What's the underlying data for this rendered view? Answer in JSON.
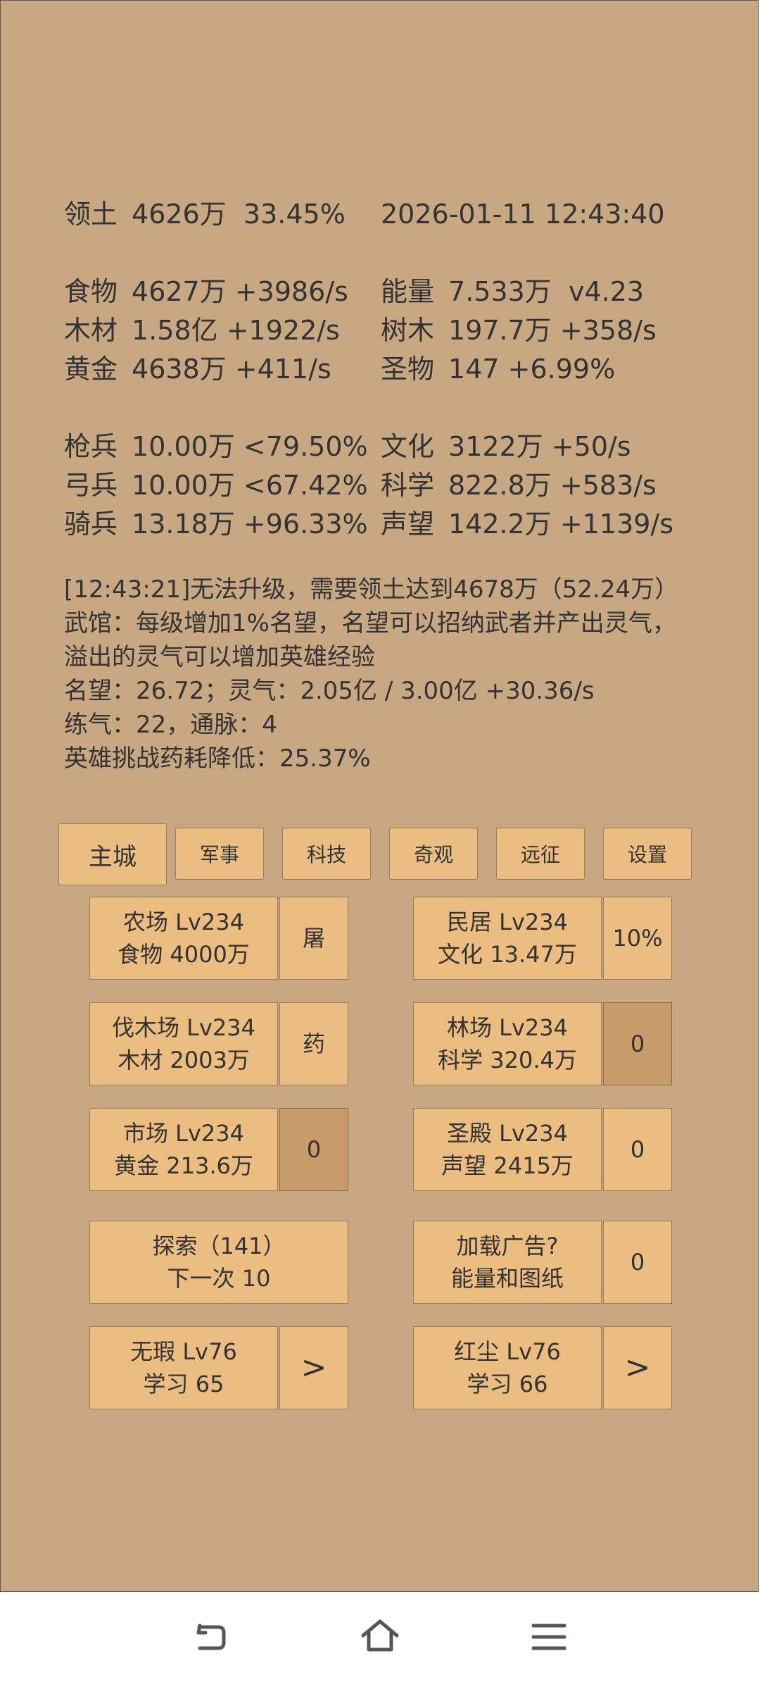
{
  "stats": {
    "territory": {
      "label": "领土",
      "value": "4626万",
      "pct": "33.45%"
    },
    "datetime": "2026-01-11 12:43:40",
    "food": {
      "label": "食物",
      "value": "4627万 +3986/s"
    },
    "energy": {
      "label": "能量",
      "value": "7.533万  v4.23"
    },
    "wood": {
      "label": "木材",
      "value": "1.58亿 +1922/s"
    },
    "trees": {
      "label": "树木",
      "value": "197.7万 +358/s"
    },
    "gold": {
      "label": "黄金",
      "value": "4638万 +411/s"
    },
    "relic": {
      "label": "圣物",
      "value": "147 +6.99%"
    },
    "spear": {
      "label": "枪兵",
      "value": "10.00万 <79.50%"
    },
    "culture": {
      "label": "文化",
      "value": "3122万 +50/s"
    },
    "archer": {
      "label": "弓兵",
      "value": "10.00万 <67.42%"
    },
    "science": {
      "label": "科学",
      "value": "822.8万 +583/s"
    },
    "cavalry": {
      "label": "骑兵",
      "value": "13.18万 +96.33%"
    },
    "fame": {
      "label": "声望",
      "value": "142.2万 +1139/s"
    }
  },
  "log": {
    "line1": "[12:43:21]无法升级，需要领土达到4678万（52.24万）",
    "line2": "武馆：每级增加1%名望，名望可以招纳武者并产出灵气，",
    "line3": "溢出的灵气可以增加英雄经验",
    "line4": "名望：26.72；灵气：2.05亿 / 3.00亿 +30.36/s",
    "line5": "练气：22，通脉：4",
    "line6": "英雄挑战药耗降低：25.37%"
  },
  "tabs": {
    "main_city": "主城",
    "military": "军事",
    "tech": "科技",
    "wonder": "奇观",
    "expedition": "远征",
    "settings": "设置"
  },
  "buildings": {
    "farm": {
      "line1": "农场 Lv234",
      "line2": "食物 4000万",
      "action": "屠"
    },
    "house": {
      "line1": "民居 Lv234",
      "line2": "文化 13.47万",
      "action": "10%"
    },
    "lumber": {
      "line1": "伐木场 Lv234",
      "line2": "木材 2003万",
      "action": "药"
    },
    "forest": {
      "line1": "林场 Lv234",
      "line2": "科学 320.4万",
      "action": "0"
    },
    "market": {
      "line1": "市场 Lv234",
      "line2": "黄金 213.6万",
      "action": "0"
    },
    "temple": {
      "line1": "圣殿 Lv234",
      "line2": "声望 2415万",
      "action": "0"
    },
    "explore": {
      "line1": "探索（141）",
      "line2": "下一次 10"
    },
    "ad": {
      "line1": "加载广告?",
      "line2": "能量和图纸",
      "action": "0"
    },
    "hero1": {
      "line1": "无瑕 Lv76",
      "line2": "学习 65",
      "action": ">"
    },
    "hero2": {
      "line1": "红尘 Lv76",
      "line2": "学习 66",
      "action": ">"
    }
  }
}
